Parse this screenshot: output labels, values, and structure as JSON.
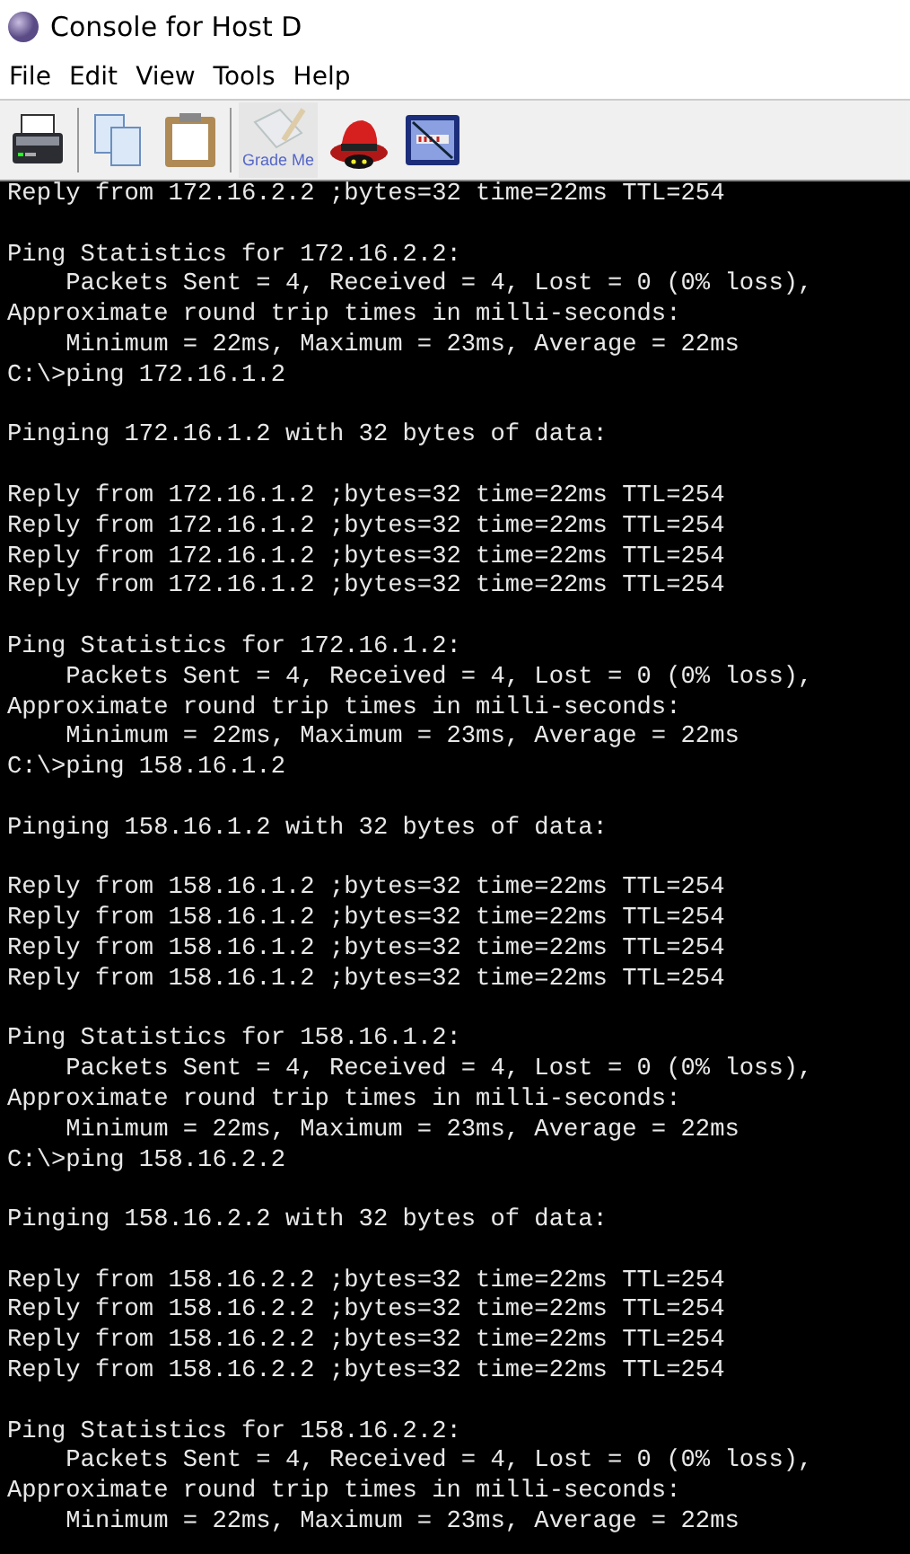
{
  "window": {
    "title": "Console for Host D"
  },
  "menu": [
    "File",
    "Edit",
    "View",
    "Tools",
    "Help"
  ],
  "toolbar": [
    {
      "kind": "print",
      "disabled": false
    },
    {
      "kind": "separator"
    },
    {
      "kind": "copy",
      "disabled": false
    },
    {
      "kind": "paste",
      "disabled": false
    },
    {
      "kind": "separator"
    },
    {
      "kind": "grade",
      "label": "Grade Me",
      "disabled": true
    },
    {
      "kind": "hat",
      "disabled": false
    },
    {
      "kind": "network",
      "disabled": false
    }
  ],
  "console": {
    "blocks": [
      [
        "Reply from 172.16.2.2 ;bytes=32 time=22ms TTL=254"
      ],
      [
        "Ping Statistics for 172.16.2.2:",
        "    Packets Sent = 4, Received = 4, Lost = 0 (0% loss),",
        "Approximate round trip times in milli-seconds:",
        "    Minimum = 22ms, Maximum = 23ms, Average = 22ms",
        "C:\\>ping 172.16.1.2"
      ],
      [
        "Pinging 172.16.1.2 with 32 bytes of data:"
      ],
      [
        "Reply from 172.16.1.2 ;bytes=32 time=22ms TTL=254",
        "Reply from 172.16.1.2 ;bytes=32 time=22ms TTL=254",
        "Reply from 172.16.1.2 ;bytes=32 time=22ms TTL=254",
        "Reply from 172.16.1.2 ;bytes=32 time=22ms TTL=254"
      ],
      [
        "Ping Statistics for 172.16.1.2:",
        "    Packets Sent = 4, Received = 4, Lost = 0 (0% loss),",
        "Approximate round trip times in milli-seconds:",
        "    Minimum = 22ms, Maximum = 23ms, Average = 22ms",
        "C:\\>ping 158.16.1.2"
      ],
      [
        "Pinging 158.16.1.2 with 32 bytes of data:"
      ],
      [
        "Reply from 158.16.1.2 ;bytes=32 time=22ms TTL=254",
        "Reply from 158.16.1.2 ;bytes=32 time=22ms TTL=254",
        "Reply from 158.16.1.2 ;bytes=32 time=22ms TTL=254",
        "Reply from 158.16.1.2 ;bytes=32 time=22ms TTL=254"
      ],
      [
        "Ping Statistics for 158.16.1.2:",
        "    Packets Sent = 4, Received = 4, Lost = 0 (0% loss),",
        "Approximate round trip times in milli-seconds:",
        "    Minimum = 22ms, Maximum = 23ms, Average = 22ms",
        "C:\\>ping 158.16.2.2"
      ],
      [
        "Pinging 158.16.2.2 with 32 bytes of data:"
      ],
      [
        "Reply from 158.16.2.2 ;bytes=32 time=22ms TTL=254",
        "Reply from 158.16.2.2 ;bytes=32 time=22ms TTL=254",
        "Reply from 158.16.2.2 ;bytes=32 time=22ms TTL=254",
        "Reply from 158.16.2.2 ;bytes=32 time=22ms TTL=254"
      ],
      [
        "Ping Statistics for 158.16.2.2:",
        "    Packets Sent = 4, Received = 4, Lost = 0 (0% loss),",
        "Approximate round trip times in milli-seconds:",
        "    Minimum = 22ms, Maximum = 23ms, Average = 22ms"
      ]
    ]
  }
}
